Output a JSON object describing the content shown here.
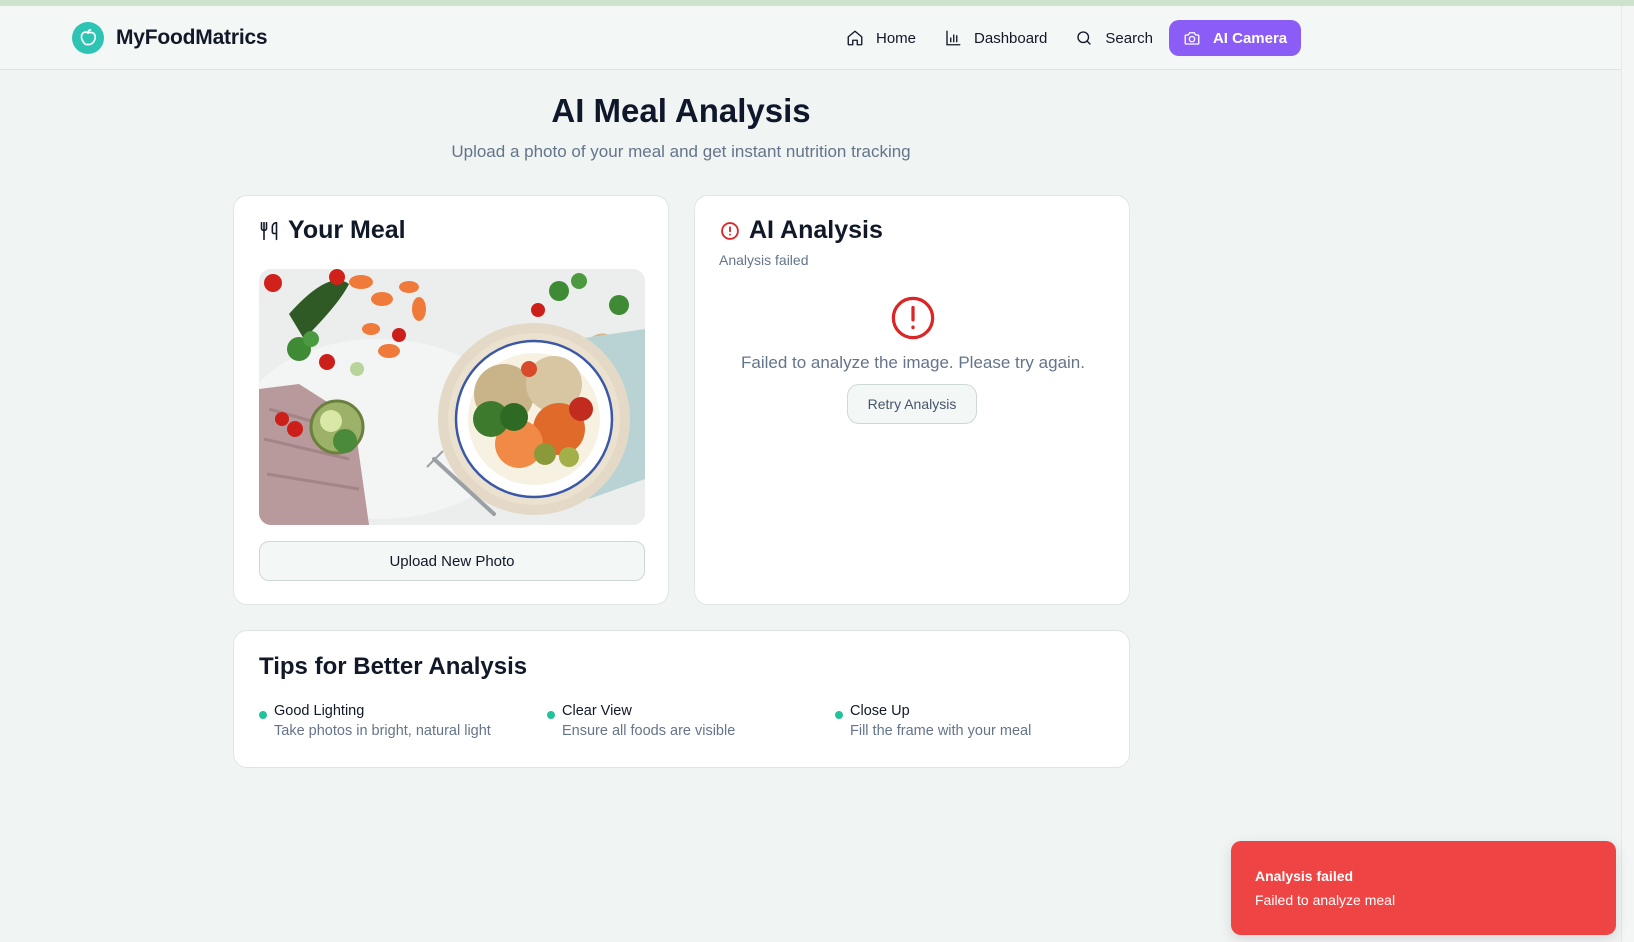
{
  "app": {
    "name": "MyFoodMatrics",
    "brand_color": "#2dc4b3",
    "accent": "#8b5cf6"
  },
  "nav": {
    "items": [
      {
        "label": "Home",
        "icon": "home-icon",
        "active": false
      },
      {
        "label": "Dashboard",
        "icon": "bar-chart-icon",
        "active": false
      },
      {
        "label": "Search",
        "icon": "search-icon",
        "active": false
      },
      {
        "label": "AI Camera",
        "icon": "camera-icon",
        "active": true
      }
    ]
  },
  "page": {
    "title": "AI Meal Analysis",
    "subtitle": "Upload a photo of your meal and get instant nutrition tracking"
  },
  "meal_card": {
    "title": "Your Meal",
    "icon": "utensils-icon",
    "upload_label": "Upload New Photo"
  },
  "ai_card": {
    "title": "AI Analysis",
    "icon": "alert-circle-icon",
    "status": "Analysis failed",
    "error_message": "Failed to analyze the image. Please try again.",
    "retry_label": "Retry Analysis",
    "error_color": "#dc2626"
  },
  "tips": {
    "title": "Tips for Better Analysis",
    "items": [
      {
        "heading": "Good Lighting",
        "text": "Take photos in bright, natural light"
      },
      {
        "heading": "Clear View",
        "text": "Ensure all foods are visible"
      },
      {
        "heading": "Close Up",
        "text": "Fill the frame with your meal"
      }
    ]
  },
  "toast": {
    "title": "Analysis failed",
    "message": "Failed to analyze meal",
    "color": "#ef4444"
  }
}
